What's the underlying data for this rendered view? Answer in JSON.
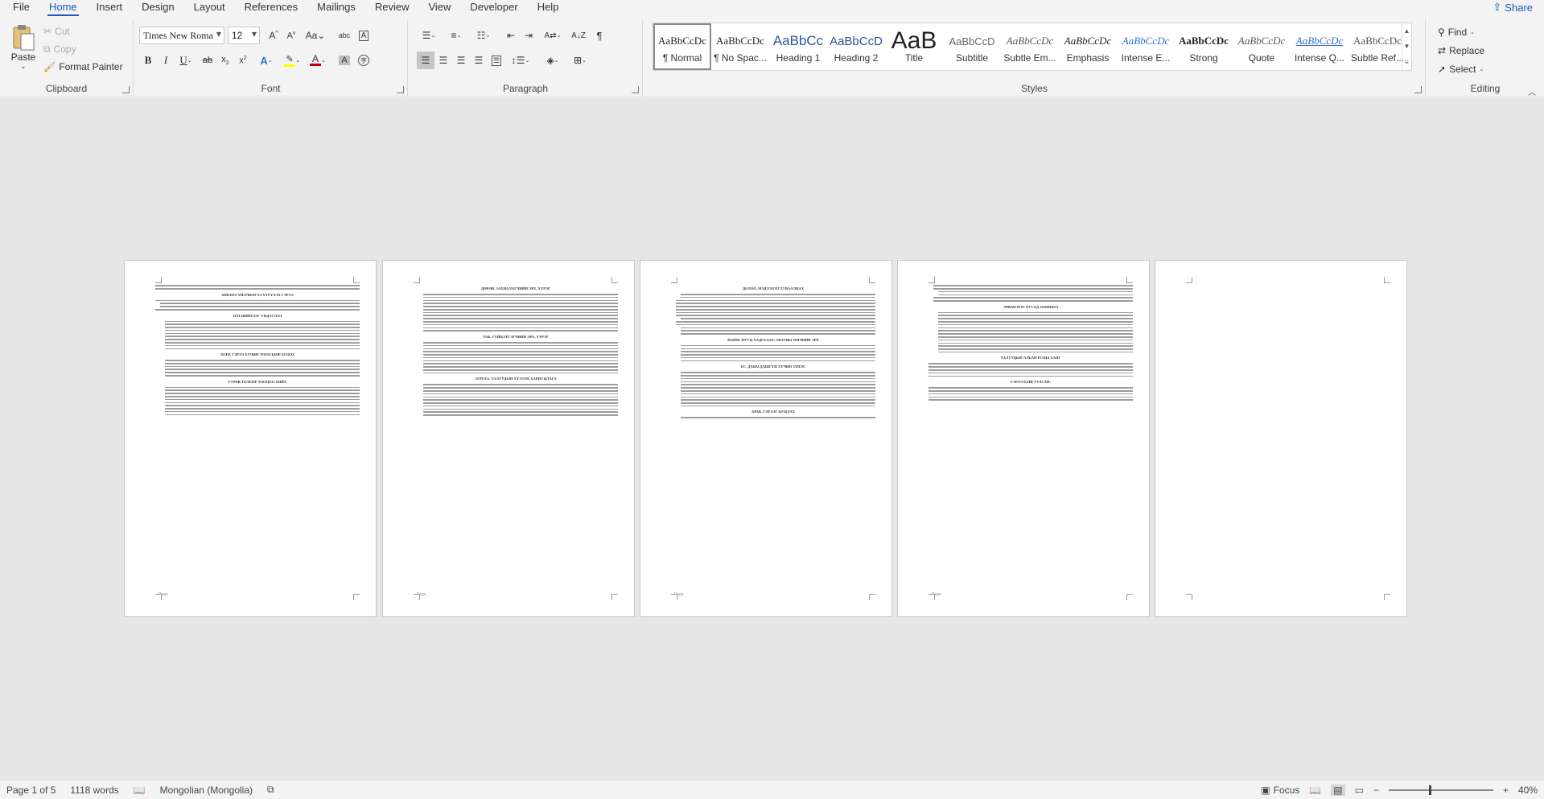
{
  "menu": {
    "tabs": [
      "File",
      "Home",
      "Insert",
      "Design",
      "Layout",
      "References",
      "Mailings",
      "Review",
      "View",
      "Developer",
      "Help"
    ],
    "active_tab": "Home",
    "share_label": "Share"
  },
  "ribbon": {
    "clipboard": {
      "label": "Clipboard",
      "paste": "Paste",
      "cut": "Cut",
      "copy": "Copy",
      "format_painter": "Format Painter"
    },
    "font": {
      "label": "Font",
      "font_name": "Times New Roma",
      "font_size": "12",
      "font_color": "#c00000",
      "highlight_color": "#ffff00"
    },
    "paragraph": {
      "label": "Paragraph"
    },
    "styles": {
      "label": "Styles",
      "items": [
        {
          "sample": "AaBbCcDc",
          "name": "¶ Normal"
        },
        {
          "sample": "AaBbCcDc",
          "name": "¶ No Spac..."
        },
        {
          "sample": "AaBbCc",
          "name": "Heading 1"
        },
        {
          "sample": "AaBbCcD",
          "name": "Heading 2"
        },
        {
          "sample": "AaB",
          "name": "Title"
        },
        {
          "sample": "AaBbCcD",
          "name": "Subtitle"
        },
        {
          "sample": "AaBbCcDc",
          "name": "Subtle Em..."
        },
        {
          "sample": "AaBbCcDc",
          "name": "Emphasis"
        },
        {
          "sample": "AaBbCcDc",
          "name": "Intense E..."
        },
        {
          "sample": "AaBbCcDc",
          "name": "Strong"
        },
        {
          "sample": "AaBbCcDc",
          "name": "Quote"
        },
        {
          "sample": "AaBbCcDc",
          "name": "Intense Q..."
        },
        {
          "sample": "AaBbCcDc",
          "name": "Subtle Ref..."
        }
      ]
    },
    "editing": {
      "label": "Editing",
      "find": "Find",
      "replace": "Replace",
      "select": "Select"
    }
  },
  "document": {
    "pages": [
      {
        "headings": [
          "ЗӨВЛӨХ ҮЙЛЧИЛГЭЭ ҮЗҮҮЛЭХ ГЭРЭЭ",
          "НЭГ.НИЙТЛЭГ ҮНДЭСЛЭЛ",
          "ХОЁР. ГЭРЭЭ ХҮЧИН ТӨГӨЛДӨР БОЛОХ",
          "ГУРАВ.ТӨЛБӨР ТООЦОО ХИЙХ"
        ],
        "footer": "Page"
      },
      {
        "headings": [
          "ДӨРӨВ. ЗАХИАЛАГЧИЙН ЭРХ, ҮҮРЭГ",
          "ТАВ. ГҮЙЦЭТГЭГЧИЙН ЭРХ, ҮҮРЭГ",
          "ЗУРГАА. ТАЛУУДЫН ХҮЛЭЭХ ХАРИУЦЛАГА"
        ],
        "footer": "Page"
      },
      {
        "headings": [
          "ДОЛОО. МЭДЭЭЛЭЛ ХУВААЛЦАХ",
          "НАЙМ. НУУЦ ХАДГАЛАХ, ОЮУНЫ ӨМЧИЙН ЭРХ",
          "ЕС. ДАВАГДАШГҮЙ ХҮЧИН ЗҮЙЛС",
          "АРАВ. ГЭРЭЭГ ЦУЦЛАХ"
        ],
        "footer": "Page"
      },
      {
        "headings": [
          "АРВАН НЭГ. БУСАД ЗОХИЦОЛ",
          "ТАЛУУДЫН АЛБАН ЁСНЫ ХАЯГ",
          "ГЭРЭЭ БАЙГУУЛСАН:"
        ],
        "footer": "Page"
      },
      {
        "headings": [],
        "footer": ""
      }
    ]
  },
  "status": {
    "page": "Page 1 of 5",
    "words": "1118 words",
    "language": "Mongolian (Mongolia)",
    "focus": "Focus",
    "zoom": "40%",
    "zoom_fraction": 0.4
  }
}
